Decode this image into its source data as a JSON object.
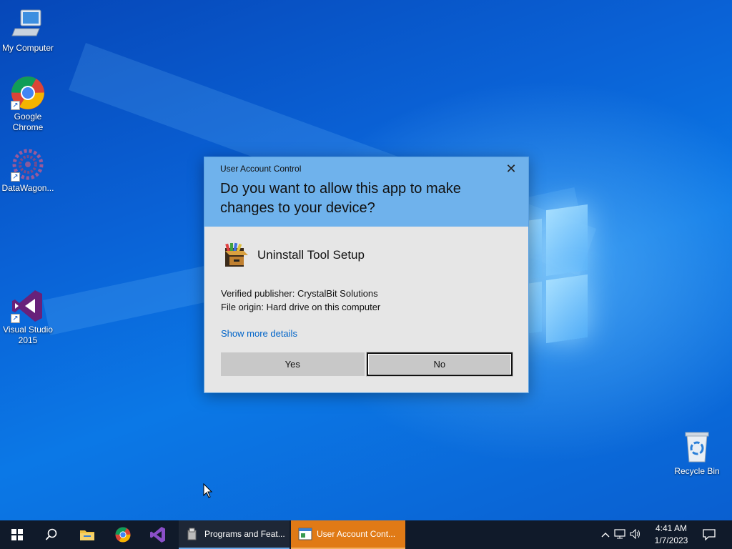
{
  "desktop": {
    "icons": [
      {
        "label": "My Computer",
        "icon": "computer-icon"
      },
      {
        "label": "Google Chrome",
        "icon": "chrome-icon"
      },
      {
        "label": "DataWagon...",
        "icon": "datawagon-icon"
      },
      {
        "label": "Visual Studio 2015",
        "icon": "visual-studio-icon"
      },
      {
        "label": "Recycle Bin",
        "icon": "recycle-bin-icon"
      }
    ]
  },
  "uac": {
    "window_title": "User Account Control",
    "question": "Do you want to allow this app to make changes to your device?",
    "app_name": "Uninstall Tool Setup",
    "publisher": "Verified publisher: CrystalBit Solutions",
    "origin": "File origin: Hard drive on this computer",
    "details_link": "Show more details",
    "yes_label": "Yes",
    "no_label": "No",
    "close_glyph": "✕"
  },
  "taskbar": {
    "start_icon": "windows-start-icon",
    "search_icon": "search-icon",
    "pinned": [
      "file-explorer-icon",
      "chrome-icon",
      "visual-studio-icon"
    ],
    "running": [
      {
        "label": "Programs and Feat...",
        "icon": "programs-features-icon"
      },
      {
        "label": "User Account Cont...",
        "icon": "uac-icon"
      }
    ],
    "time": "4:41 AM",
    "date": "1/7/2023"
  },
  "colors": {
    "desktop_blue": "#0a62d6",
    "uac_header": "#6fb2ec",
    "uac_body": "#e6e6e6",
    "taskbar": "#101a2a",
    "active_task": "#e07a16",
    "link": "#0064c8"
  }
}
